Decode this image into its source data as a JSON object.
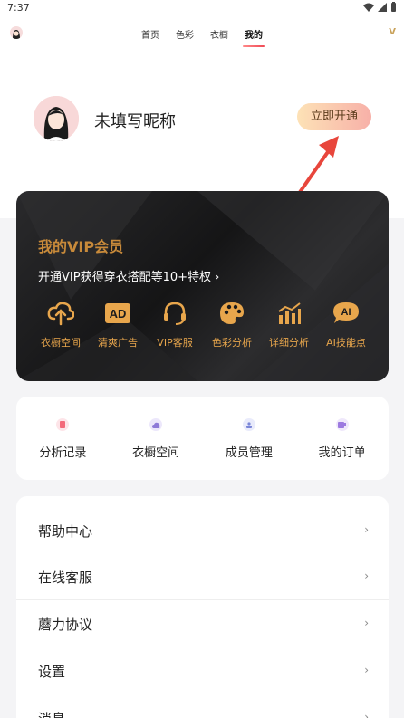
{
  "status": {
    "time": "7:37"
  },
  "nav": {
    "tabs": [
      "首页",
      "色彩",
      "衣橱",
      "我的"
    ],
    "active_tab": "我的",
    "vip_mark": "V"
  },
  "profile": {
    "nickname": "未填写昵称",
    "open_button": "立即开通"
  },
  "vip": {
    "title": "我的VIP会员",
    "subtitle": "开通VIP获得穿衣搭配等10+特权 ›",
    "perks": [
      {
        "label": "衣橱空间",
        "icon": "cloud-upload-icon"
      },
      {
        "label": "清爽广告",
        "icon": "ad-icon"
      },
      {
        "label": "VIP客服",
        "icon": "headset-icon"
      },
      {
        "label": "色彩分析",
        "icon": "palette-icon"
      },
      {
        "label": "详细分析",
        "icon": "bar-chart-icon"
      },
      {
        "label": "AI技能点",
        "icon": "ai-icon"
      }
    ],
    "accent": "#e8a64c"
  },
  "quick_menu": [
    {
      "label": "分析记录",
      "icon": "record-icon",
      "color": "#f36a7a"
    },
    {
      "label": "衣橱空间",
      "icon": "cloud-icon",
      "color": "#8e7ad8"
    },
    {
      "label": "成员管理",
      "icon": "members-icon",
      "color": "#7a86d8"
    },
    {
      "label": "我的订单",
      "icon": "order-icon",
      "color": "#9c7ae0"
    }
  ],
  "list": [
    {
      "label": "帮助中心",
      "chevron": "›"
    },
    {
      "label": "在线客服",
      "chevron": "›"
    },
    {
      "label": "蘑力协议",
      "chevron": "›"
    },
    {
      "label": "设置",
      "chevron": "›"
    },
    {
      "label": "消息",
      "chevron": "›"
    }
  ]
}
